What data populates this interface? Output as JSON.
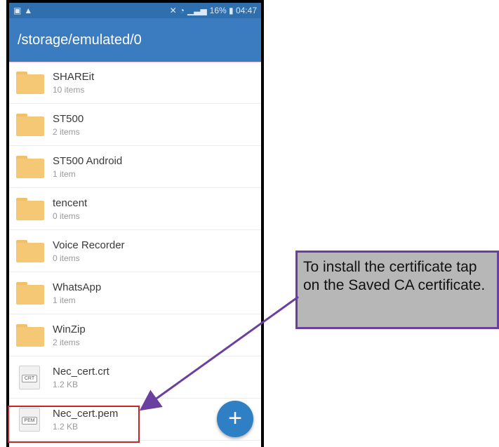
{
  "status_bar": {
    "left_icons": [
      "notification-icon",
      "warning-icon"
    ],
    "right_text": "16% ▮ 04:47",
    "right_icons": [
      "mute-icon",
      "wifi-icon",
      "signal-icon",
      "battery-icon"
    ]
  },
  "app_bar": {
    "path": "/storage/emulated/0"
  },
  "items": [
    {
      "type": "folder",
      "name": "SHAREit",
      "meta": "10 items"
    },
    {
      "type": "folder",
      "name": "ST500",
      "meta": "2 items"
    },
    {
      "type": "folder",
      "name": "ST500 Android",
      "meta": "1 item"
    },
    {
      "type": "folder",
      "name": "tencent",
      "meta": "0 items"
    },
    {
      "type": "folder",
      "name": "Voice Recorder",
      "meta": "0 items"
    },
    {
      "type": "folder",
      "name": "WhatsApp",
      "meta": "1 item"
    },
    {
      "type": "folder",
      "name": "WinZip",
      "meta": "2 items"
    },
    {
      "type": "file",
      "ext": "CRT",
      "name": "Nec_cert.crt",
      "meta": "1.2 KB"
    },
    {
      "type": "file",
      "ext": "PEM",
      "name": "Nec_cert.pem",
      "meta": "1.2 KB"
    }
  ],
  "fab": {
    "label": "+"
  },
  "callout": {
    "text": "To install the certificate tap on the Saved CA certificate."
  },
  "colors": {
    "status_bar": "#2f6fae",
    "app_bar": "#3a7cbf",
    "folder": "#f5c876",
    "fab": "#2f7fc4",
    "highlight": "#c0272d",
    "callout_border": "#6b3fa0",
    "callout_bg": "#b7b7b7"
  }
}
